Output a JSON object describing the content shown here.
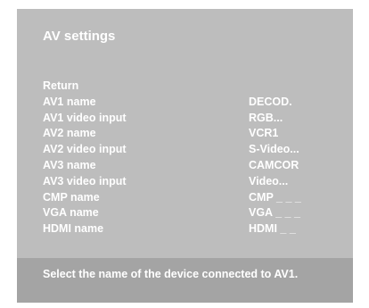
{
  "title": "AV settings",
  "menu": [
    {
      "label": "Return",
      "value": ""
    },
    {
      "label": "AV1 name",
      "value": "DECOD."
    },
    {
      "label": "AV1 video input",
      "value": "RGB..."
    },
    {
      "label": "AV2 name",
      "value": "VCR1"
    },
    {
      "label": "AV2 video input",
      "value": "S-Video..."
    },
    {
      "label": "AV3 name",
      "value": "CAMCOR"
    },
    {
      "label": "AV3 video input",
      "value": "Video..."
    },
    {
      "label": "CMP name",
      "value": "CMP _ _ _"
    },
    {
      "label": "VGA name",
      "value": "VGA _ _ _"
    },
    {
      "label": "HDMI name",
      "value": "HDMI _ _"
    }
  ],
  "help": "Select the name of the device connected to AV1.",
  "colors": {
    "panel": "#bdbdbd",
    "help_bar": "#a4a4a4",
    "text": "#ffffff"
  }
}
